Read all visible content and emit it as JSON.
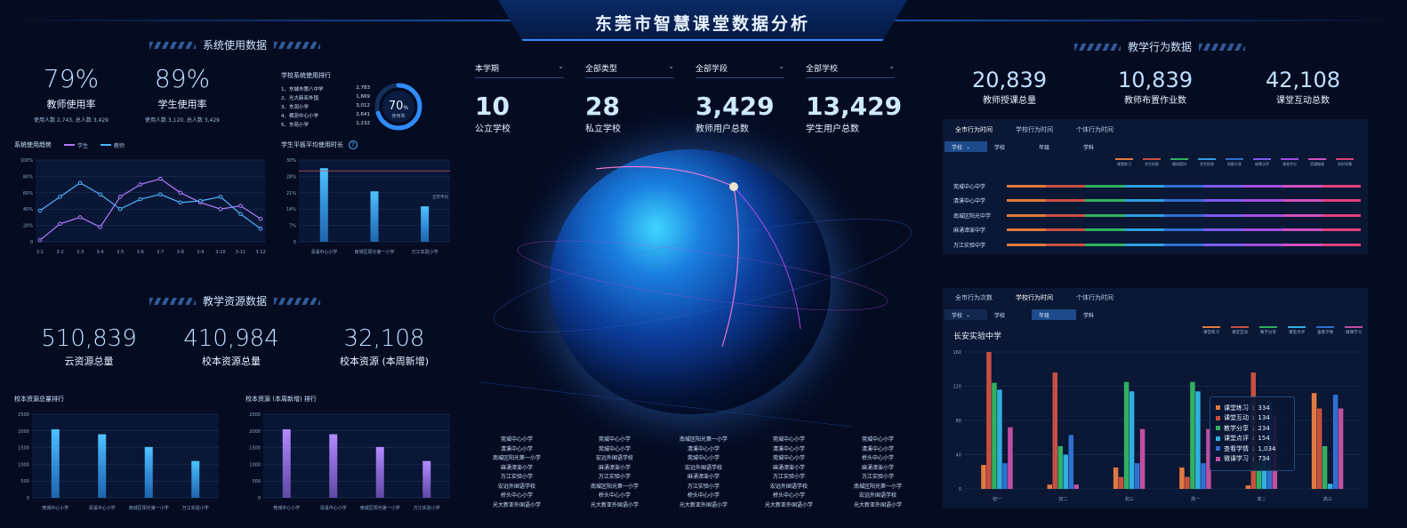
{
  "header": {
    "title": "东莞市智慧课堂数据分析"
  },
  "system": {
    "section_title": "系统使用数据",
    "teacher_rate": "79%",
    "teacher_rate_label": "教师使用率",
    "teacher_rate_sub": "使用人数 2,743, 总人数 3,429",
    "student_rate": "89%",
    "student_rate_label": "学生使用率",
    "student_rate_sub": "使用人数 3,120, 总人数 3,429",
    "ranking_title": "学校系统使用排行",
    "ranking": [
      {
        "name": "1、东城市第八中学",
        "value": "2,783"
      },
      {
        "name": "2、光大新亚外国",
        "value": "1,669"
      },
      {
        "name": "3、东润小学",
        "value": "3,012"
      },
      {
        "name": "4、横沥中心小学",
        "value": "2,641"
      },
      {
        "name": "5、东苑小学",
        "value": "1,232"
      }
    ],
    "donut_value": "70",
    "donut_unit": "%",
    "donut_label": "使用率",
    "donut_fraction": 0.7,
    "trend_title": "系统使用趋势",
    "trend_legend_student": "学生",
    "trend_legend_teacher": "教师",
    "tablet_title": "学生平板平均使用时长",
    "help_icon": "?"
  },
  "resource": {
    "section_title": "教学资源数据",
    "cloud_total": "510,839",
    "cloud_total_label": "云资源总量",
    "school_total": "410,984",
    "school_total_label": "校本资源总量",
    "school_week": "32,108",
    "school_week_label": "校本资源 (本周新增)",
    "rank1_title": "校本资源总量排行",
    "rank2_title": "校本资源 (本周新增) 排行"
  },
  "filters": [
    {
      "label": "本学期"
    },
    {
      "label": "全部类型"
    },
    {
      "label": "全部学段"
    },
    {
      "label": "全部学校"
    }
  ],
  "center_stats": [
    {
      "value": "10",
      "label": "公立学校"
    },
    {
      "value": "28",
      "label": "私立学校"
    },
    {
      "value": "3,429",
      "label": "教师用户总数"
    },
    {
      "value": "13,429",
      "label": "学生用户总数"
    }
  ],
  "school_columns": [
    [
      "莞城中心小学",
      "清溪中心小学",
      "南城区阳光第一小学",
      "麻涌漳澎小学",
      "万江实验小学",
      "宏远外国语学校",
      "桥头中心小学",
      "光大新亚外国语小学"
    ],
    [
      "莞城中心小学",
      "莞城中心小学",
      "宏远外国语学校",
      "麻涌漳澎小学",
      "万江实验小学",
      "南城区阳光第一小学",
      "桥头中心小学",
      "光大新亚外国语小学"
    ],
    [
      "南城区阳光第一小学",
      "清溪中心小学",
      "莞城中心小学",
      "宏远外国语学校",
      "麻涌漳澎小学",
      "万江实验小学",
      "桥头中心小学",
      "光大新亚外国语小学"
    ],
    [
      "莞城中心小学",
      "清溪中心小学",
      "莞城中心小学",
      "麻涌漳澎小学",
      "万江实验小学",
      "宏远外国语学校",
      "桥头中心小学",
      "光大新亚外国语小学"
    ],
    [
      "莞城中心小学",
      "清溪中心小学",
      "桥头中心小学",
      "麻涌漳澎小学",
      "万江实验小学",
      "南城区阳光第一小学",
      "宏远外国语学校",
      "光大新亚外国语小学"
    ]
  ],
  "teaching": {
    "section_title": "教学行为数据",
    "stats": [
      {
        "value": "20,839",
        "label": "教师授课总量"
      },
      {
        "value": "10,839",
        "label": "教师布置作业数"
      },
      {
        "value": "42,108",
        "label": "课堂互动总数"
      }
    ],
    "panel1_tabs": [
      "全市行为时间",
      "学校行为时间",
      "个体行为时间"
    ],
    "panel1_subtabs": [
      "学校",
      "学校",
      "年级",
      "学科"
    ],
    "panel1_legend": [
      "课堂练习",
      "学生拍照",
      "随机提问",
      "学生抢答",
      "同屏分享",
      "成果点评",
      "课堂评分",
      "资源链接",
      "实时学情"
    ],
    "panel1_rows": [
      "莞城中心中学",
      "清溪中心中学",
      "南城区阳光中学",
      "麻涌漳澎中学",
      "万江实验中学"
    ],
    "panel2_tabs": [
      "全市行为次数",
      "学校行为时间",
      "个体行为时间"
    ],
    "panel2_subtabs": [
      "学校",
      "学校",
      "年级",
      "学科"
    ],
    "panel2_school": "长安实验中学",
    "panel2_legend": [
      "课堂练习",
      "课堂互动",
      "教学分享",
      "课堂点评",
      "查看学情",
      "微课学习"
    ],
    "tooltip": [
      {
        "label": "课堂练习",
        "value": "334"
      },
      {
        "label": "课堂互动",
        "value": "134"
      },
      {
        "label": "教学分享",
        "value": "234"
      },
      {
        "label": "课堂点评",
        "value": "154"
      },
      {
        "label": "查看学情",
        "value": "1,034"
      },
      {
        "label": "微课学习",
        "value": "734"
      }
    ]
  },
  "colors": {
    "accent": "#2f8cff",
    "student_line": "#b07cff",
    "teacher_line": "#4fb3ff",
    "bar_blue": "#2d9bff",
    "bar_purple": "#9a6cf0"
  },
  "chart_data": [
    {
      "type": "line",
      "title": "系统使用趋势",
      "x": [
        "3-1",
        "3-2",
        "3-3",
        "3-4",
        "3-5",
        "3-6",
        "3-7",
        "3-8",
        "3-9",
        "3-10",
        "3-11",
        "3-12"
      ],
      "ylim": [
        0,
        100
      ],
      "yticks": [
        "0",
        "20%",
        "40%",
        "60%",
        "80%",
        "100%"
      ],
      "series": [
        {
          "name": "学生",
          "values": [
            2,
            22,
            30,
            18,
            55,
            70,
            77,
            60,
            48,
            40,
            44,
            28
          ]
        },
        {
          "name": "教师",
          "values": [
            38,
            55,
            72,
            58,
            40,
            52,
            58,
            48,
            50,
            55,
            34,
            16
          ]
        }
      ]
    },
    {
      "type": "bar",
      "title": "学生平板平均使用时长",
      "categories": [
        "清溪中心小学",
        "南城区阳光第一小学",
        "万江实验小学"
      ],
      "values": [
        27,
        18.5,
        13
      ],
      "ylim": [
        0,
        30
      ],
      "yticks": [
        "0",
        "7%",
        "14%",
        "21%",
        "28%",
        "30%"
      ],
      "reference_label": "全市平均"
    },
    {
      "type": "bar",
      "title": "校本资源总量排行",
      "categories": [
        "莞城中心小学",
        "清溪中心小学",
        "南城区阳光第一小学",
        "万江实验小学"
      ],
      "values": [
        2050,
        1900,
        1520,
        1100
      ],
      "ylim": [
        0,
        2500
      ],
      "yticks": [
        "0",
        "500",
        "1000",
        "1500",
        "2000",
        "2500"
      ]
    },
    {
      "type": "bar",
      "title": "校本资源 (本周新增) 排行",
      "categories": [
        "莞城中心小学",
        "清溪中心小学",
        "南城区阳光第一小学",
        "万江实验小学"
      ],
      "values": [
        2050,
        1900,
        1520,
        1100
      ],
      "ylim": [
        0,
        2500
      ],
      "yticks": [
        "0",
        "500",
        "1000",
        "1500",
        "2000",
        "2500"
      ]
    },
    {
      "type": "bar",
      "title": "长安实验中学",
      "categories": [
        "初一",
        "初二",
        "初三",
        "高一",
        "高二",
        "高三"
      ],
      "ylim": [
        0,
        160
      ],
      "yticks": [
        "0",
        "40",
        "80",
        "120",
        "160"
      ],
      "series": [
        {
          "name": "课堂练习",
          "values": [
            28,
            5,
            25,
            25,
            4,
            112
          ]
        },
        {
          "name": "课堂互动",
          "values": [
            160,
            136,
            14,
            14,
            136,
            94
          ]
        },
        {
          "name": "教学分享",
          "values": [
            124,
            50,
            125,
            125,
            32,
            50
          ]
        },
        {
          "name": "课堂点评",
          "values": [
            116,
            40,
            114,
            114,
            40,
            6
          ]
        },
        {
          "name": "查看学情",
          "values": [
            30,
            63,
            30,
            30,
            103,
            110
          ]
        },
        {
          "name": "微课学习",
          "values": [
            72,
            5,
            70,
            70,
            86,
            94
          ]
        }
      ]
    }
  ]
}
